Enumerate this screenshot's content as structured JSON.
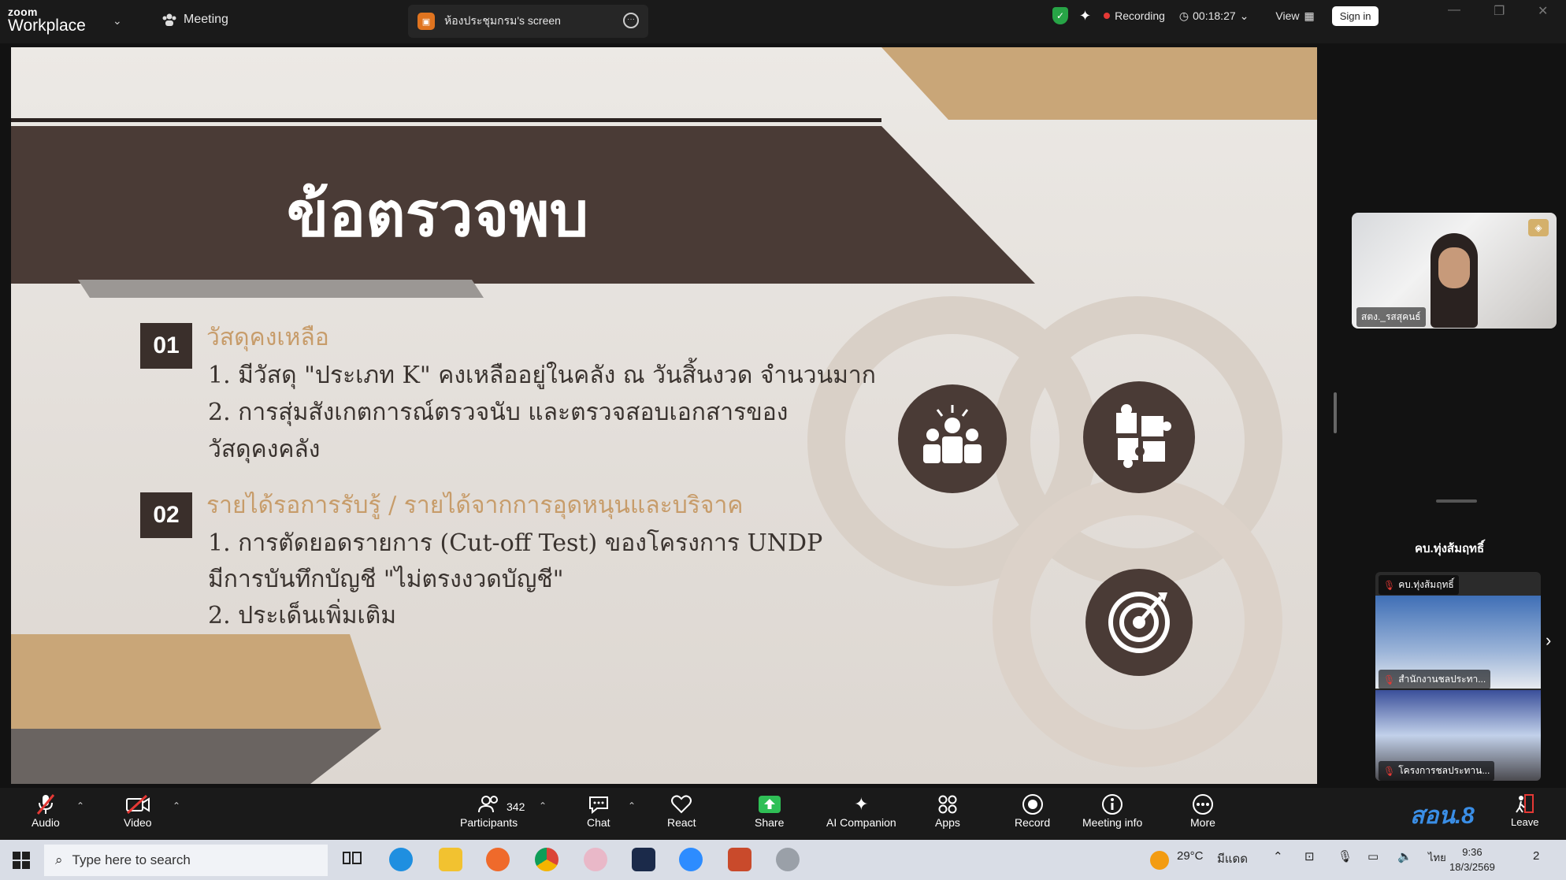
{
  "app": {
    "brand_small": "zoom",
    "brand_name": "Workplace",
    "meeting_label": "Meeting",
    "share_tab_title": "ห้องประชุมกรม's screen",
    "recording_label": "Recording",
    "timer": "00:18:27",
    "view_label": "View",
    "signin_label": "Sign in"
  },
  "slide": {
    "title": "ข้อตรวจพบ",
    "sections": [
      {
        "number": "01",
        "heading": "วัสดุคงเหลือ",
        "lines": [
          "1. มีวัสดุ \"ประเภท K\" คงเหลืออยู่ในคลัง ณ วันสิ้นงวด จำนวนมาก",
          "2. การสุ่มสังเกตการณ์ตรวจนับ และตรวจสอบเอกสารของ",
          "วัสดุคงคลัง"
        ]
      },
      {
        "number": "02",
        "heading": "รายได้รอการรับรู้ / รายได้จากการอุดหนุนและบริจาค",
        "lines": [
          "1. การตัดยอดรายการ (Cut-off Test) ของโครงการ UNDP",
          "มีการบันทึกบัญชี \"ไม่ตรงงวดบัญชี\"",
          "2. ประเด็นเพิ่มเติม"
        ]
      }
    ],
    "icons": [
      "team-icon",
      "puzzle-icon",
      "target-icon"
    ],
    "colors": {
      "dark_band": "#4a3b36",
      "tan_accent": "#c9a678",
      "heading_gold": "#c79c6a"
    }
  },
  "panel": {
    "cam1_name": "สตง._รสสุคนธ์",
    "speaker_name": "คบ.ทุ่งส้มฤทธิ์",
    "cam2_top_label": "คบ.ทุ่งส้มฤทธิ์",
    "cam2_mid_label": "สำนักงานชลประทา...",
    "cam2_bottom_label": "โครงการชลประทาน..."
  },
  "toolbar": {
    "audio": "Audio",
    "video": "Video",
    "participants": "Participants",
    "participant_count": "342",
    "chat": "Chat",
    "react": "React",
    "share": "Share",
    "ai_companion": "AI Companion",
    "apps": "Apps",
    "record": "Record",
    "meeting_info": "Meeting info",
    "more": "More",
    "leave": "Leave",
    "station_logo": "สอน.8"
  },
  "taskbar": {
    "search_placeholder": "Type here to search",
    "temperature": "29°C",
    "weather": "มีแดด",
    "language": "ไทย",
    "time": "9:36",
    "date": "18/3/2569",
    "notification_count": "2"
  }
}
